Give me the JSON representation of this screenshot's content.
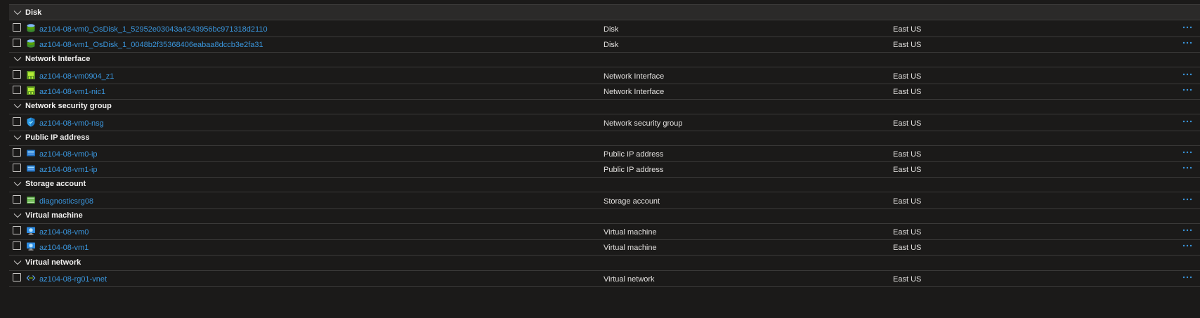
{
  "groups": [
    {
      "label": "Disk",
      "items": [
        {
          "name": "az104-08-vm0_OsDisk_1_52952e03043a4243956bc971318d2110",
          "type": "Disk",
          "location": "East US",
          "icon": "disk-icon"
        },
        {
          "name": "az104-08-vm1_OsDisk_1_0048b2f35368406eabaa8dccb3e2fa31",
          "type": "Disk",
          "location": "East US",
          "icon": "disk-icon"
        }
      ]
    },
    {
      "label": "Network Interface",
      "items": [
        {
          "name": "az104-08-vm0904_z1",
          "type": "Network Interface",
          "location": "East US",
          "icon": "network-interface-icon"
        },
        {
          "name": "az104-08-vm1-nic1",
          "type": "Network Interface",
          "location": "East US",
          "icon": "network-interface-icon"
        }
      ]
    },
    {
      "label": "Network security group",
      "items": [
        {
          "name": "az104-08-vm0-nsg",
          "type": "Network security group",
          "location": "East US",
          "icon": "shield-icon"
        }
      ]
    },
    {
      "label": "Public IP address",
      "items": [
        {
          "name": "az104-08-vm0-ip",
          "type": "Public IP address",
          "location": "East US",
          "icon": "public-ip-icon"
        },
        {
          "name": "az104-08-vm1-ip",
          "type": "Public IP address",
          "location": "East US",
          "icon": "public-ip-icon"
        }
      ]
    },
    {
      "label": "Storage account",
      "items": [
        {
          "name": "diagnosticsrg08",
          "type": "Storage account",
          "location": "East US",
          "icon": "storage-account-icon"
        }
      ]
    },
    {
      "label": "Virtual machine",
      "items": [
        {
          "name": "az104-08-vm0",
          "type": "Virtual machine",
          "location": "East US",
          "icon": "virtual-machine-icon"
        },
        {
          "name": "az104-08-vm1",
          "type": "Virtual machine",
          "location": "East US",
          "icon": "virtual-machine-icon"
        }
      ]
    },
    {
      "label": "Virtual network",
      "items": [
        {
          "name": "az104-08-rg01-vnet",
          "type": "Virtual network",
          "location": "East US",
          "icon": "virtual-network-icon"
        }
      ]
    }
  ],
  "colors": {
    "link": "#3a96dd",
    "background": "#1b1a19",
    "divider": "#3b3a39"
  }
}
